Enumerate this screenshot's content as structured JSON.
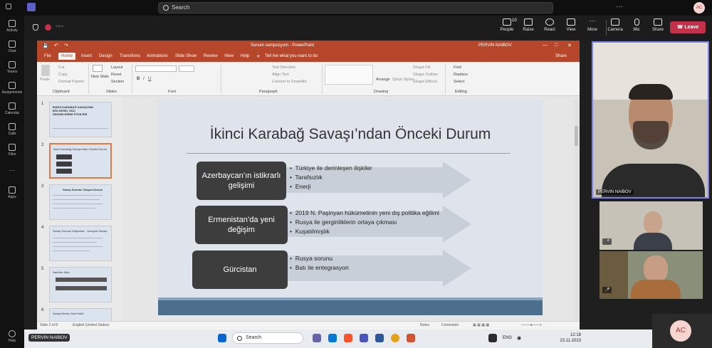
{
  "teams": {
    "search_label": "Search",
    "avatar_initials": "AC",
    "rail": [
      "Activity",
      "Chat",
      "Teams",
      "Assignments",
      "Calendar",
      "Calls",
      "Files",
      "Apps",
      "Help"
    ],
    "meeting_timer": "--:--",
    "toolbar": {
      "people_count": "10",
      "people": "People",
      "raise": "Raise",
      "react": "React",
      "view": "View",
      "more": "More",
      "camera": "Camera",
      "mic": "Mic",
      "share": "Share",
      "leave": "Leave"
    }
  },
  "powerpoint": {
    "window_title": "Sunum sempozyum  -  PowerPoint",
    "user": "PERVIN NAIBOV",
    "tabs": [
      "File",
      "Home",
      "Insert",
      "Design",
      "Transitions",
      "Animations",
      "Slide Show",
      "Review",
      "View",
      "Help"
    ],
    "tell_me": "Tell me what you want to do",
    "share": "Share",
    "ribbon": {
      "paste": "Paste",
      "cut": "Cut",
      "copy": "Copy",
      "format_painter": "Format Painter",
      "new_slide": "New Slide",
      "layout": "Layout",
      "reset": "Reset",
      "section": "Section",
      "text_direction": "Text Direction",
      "align_text": "Align Text",
      "convert_smartart": "Convert to SmartArt",
      "arrange": "Arrange",
      "quick_styles": "Quick Styles",
      "shape_fill": "Shape Fill",
      "shape_outline": "Shape Outline",
      "shape_effects": "Shape Effects",
      "find": "Find",
      "replace": "Replace",
      "select": "Select",
      "groups": [
        "Clipboard",
        "Slides",
        "Font",
        "Paragraph",
        "Drawing",
        "Editing"
      ]
    },
    "thumbnails": [
      {
        "num": "1",
        "title": "İKİNCİ KARABAĞ SAVAŞI'NIN BÖLGESEL GÜÇ DENGELERİNE ETKİLERİ"
      },
      {
        "num": "2",
        "title": "İkinci Karabağ Savaşı'ndan Önceki Durum"
      },
      {
        "num": "3",
        "title": "Savaş Sonrası Oluşan Durum"
      },
      {
        "num": "4",
        "title": "Savaş Sonrası Kaliyonlar - Ukrayna Savaşı"
      },
      {
        "num": "5",
        "title": "Nasl'ten Nalo"
      },
      {
        "num": "6",
        "title": "Savaş Neden Özel Kaldı"
      }
    ],
    "slide": {
      "title": "İkinci Karabağ Savaşı’ndan Önceki Durum",
      "rows": [
        {
          "box": "Azerbaycan’ın istikrarlı gelişimi",
          "bullets": [
            "Türkiye ile derinleşen ilişkiler",
            "Tarafsızlık",
            "Enerji"
          ]
        },
        {
          "box": "Ermenistan’da yeni değişim",
          "bullets": [
            "2019 N. Paşinyan hükümetinin yeni dış politika eğilimi",
            "Rusya ile gerginliklerin ortaya çıkması",
            "Kuşatılmışlık"
          ]
        },
        {
          "box": "Gürcistan",
          "bullets": [
            "Rusya sorunu",
            "Batı ile entegrasyon"
          ]
        }
      ]
    },
    "status": {
      "slide_of": "Slide 2 of 8",
      "language": "English (United States)",
      "notes": "Notes",
      "comments": "Comments"
    }
  },
  "participants": [
    {
      "name": "PERVIN NAIBOV"
    },
    {
      "name": ""
    },
    {
      "name": ""
    }
  ],
  "taskbar": {
    "search": "Search",
    "lang": "ENG",
    "time": "12:18",
    "date": "23.11.2023",
    "presenter": "PERVIN NAIBOV"
  },
  "colors": {
    "ppt_accent": "#b7472a",
    "leave": "#c4314b",
    "slide_box": "#3d3d3d",
    "active_border": "#7b83eb"
  }
}
